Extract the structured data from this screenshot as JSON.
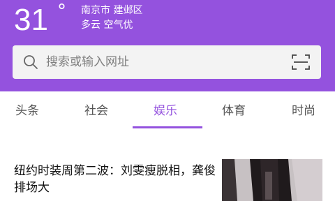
{
  "weather": {
    "temperature": "31",
    "unit": "°",
    "location": "南京市 建邺区",
    "condition": "多云 空气优"
  },
  "search": {
    "placeholder": "搜索或输入网址"
  },
  "icons": {
    "search": "search-icon",
    "scan": "scan-icon"
  },
  "tabs": [
    {
      "label": "头条"
    },
    {
      "label": "社会"
    },
    {
      "label": "娱乐",
      "active": true
    },
    {
      "label": "体育"
    },
    {
      "label": "时尚"
    }
  ],
  "article": {
    "title": "纽约时装周第二波：刘雯瘦脱相，龚俊排场大"
  },
  "colors": {
    "accent": "#9452de",
    "search_bg": "#f3f3f3",
    "tab_text": "#555555"
  }
}
